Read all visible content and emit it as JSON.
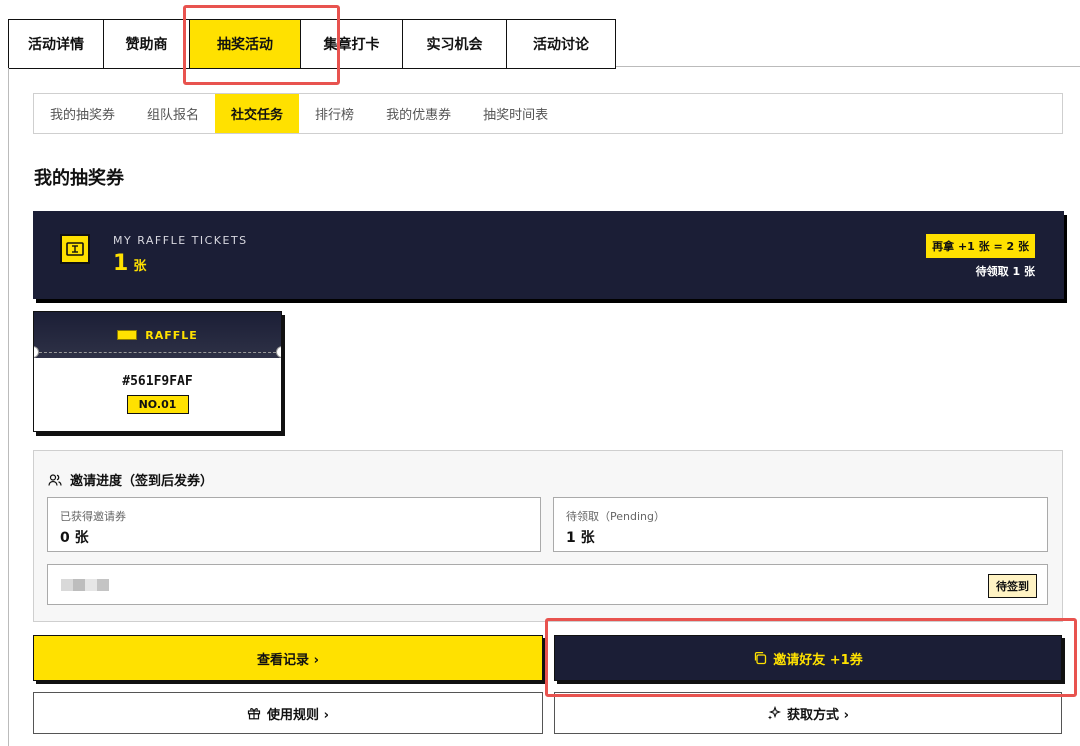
{
  "top_tabs": [
    {
      "label": "活动详情",
      "active": false
    },
    {
      "label": "赞助商",
      "active": false
    },
    {
      "label": "抽奖活动",
      "active": true
    },
    {
      "label": "集章打卡",
      "active": false
    },
    {
      "label": "实习机会",
      "active": false
    },
    {
      "label": "活动讨论",
      "active": false
    }
  ],
  "sub_tabs": [
    {
      "label": "我的抽奖券",
      "active": false
    },
    {
      "label": "组队报名",
      "active": false
    },
    {
      "label": "社交任务",
      "active": true
    },
    {
      "label": "排行榜",
      "active": false
    },
    {
      "label": "我的优惠券",
      "active": false
    },
    {
      "label": "抽奖时间表",
      "active": false
    }
  ],
  "section_title": "我的抽奖券",
  "ticket_panel": {
    "label": "MY RAFFLE TICKETS",
    "count": "1",
    "unit": "张",
    "badge": "再拿 +1 张 = 2 张",
    "pending": "待领取 1 张",
    "icon": "ticket-icon"
  },
  "raffle_card": {
    "label": "RAFFLE",
    "code": "#561F9FAF",
    "number": "NO.01"
  },
  "invite": {
    "title": "邀请进度（签到后发券）",
    "icon": "users-icon",
    "earned_label": "已获得邀请券",
    "earned_value": "0 张",
    "pending_label": "待领取（Pending）",
    "pending_value": "1 张",
    "friend_status": "待签到"
  },
  "buttons": {
    "records": "查看记录 ›",
    "invite": "邀请好友 +1券",
    "rules": "使用规则 ›",
    "howto": "获取方式 ›"
  },
  "colors": {
    "accent": "#ffe100",
    "navy": "#1b1e36",
    "highlight": "#e8534f"
  }
}
